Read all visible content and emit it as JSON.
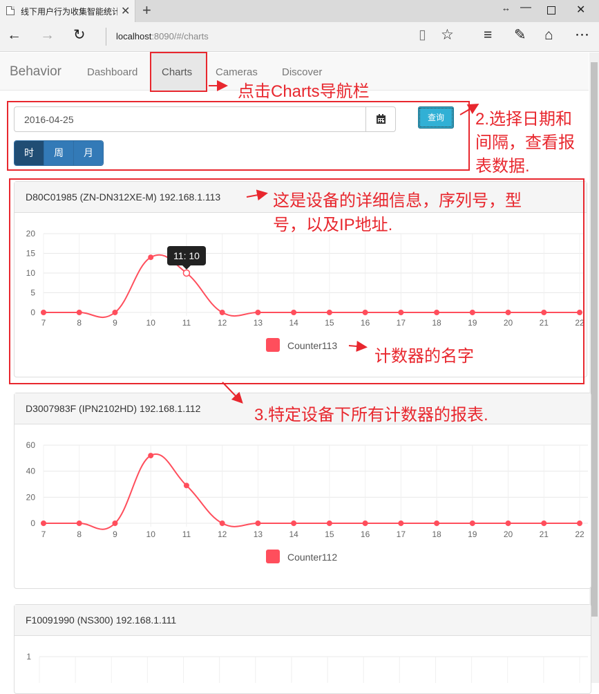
{
  "browser": {
    "tab_title": "线下用户行为收集智能统计",
    "address_host": "localhost",
    "address_rest": ":8090/#/charts",
    "newtab_glyph": "+",
    "close_glyph": "✕"
  },
  "app": {
    "brand": "Behavior",
    "nav": [
      {
        "label": "Dashboard"
      },
      {
        "label": "Charts",
        "active": true
      },
      {
        "label": "Cameras"
      },
      {
        "label": "Discover"
      }
    ]
  },
  "controls": {
    "date_value": "2016-04-25",
    "query_label": "查询",
    "intervals": [
      {
        "label": "时",
        "active": true
      },
      {
        "label": "周"
      },
      {
        "label": "月"
      }
    ]
  },
  "devices": [
    {
      "header": "D80C01985 (ZN-DN312XE-M) 192.168.1.113",
      "legend": "Counter113",
      "tooltip": "11: 10"
    },
    {
      "header": "D3007983F (IPN2102HD) 192.168.1.112",
      "legend": "Counter112"
    },
    {
      "header": "F10091990 (NS300) 192.168.1.111"
    }
  ],
  "annotations": {
    "a1": "点击Charts导航栏",
    "a2_line1": "2.选择日期和",
    "a2_line2": "间隔，查看报",
    "a2_line3": "表数据.",
    "a3_line1": "这是设备的详细信息，序列号，型",
    "a3_line2": "号，以及IP地址.",
    "a4": "计数器的名字",
    "a5": "3.特定设备下所有计数器的报表."
  },
  "colors": {
    "series": "#ff4e5c",
    "annotation": "#e8272e",
    "primary": "#337ab7",
    "query": "#31b0d5"
  },
  "chart_data": [
    {
      "type": "line",
      "x": [
        7,
        8,
        9,
        10,
        11,
        12,
        13,
        14,
        15,
        16,
        17,
        18,
        19,
        20,
        21,
        22
      ],
      "series": [
        {
          "name": "Counter113",
          "values": [
            0,
            0,
            0,
            14,
            10,
            0,
            0,
            0,
            0,
            0,
            0,
            0,
            0,
            0,
            0,
            0
          ]
        }
      ],
      "yticks": [
        0,
        5,
        10,
        15,
        20
      ],
      "ylim": [
        0,
        20
      ],
      "grid": true,
      "legend": "bottom"
    },
    {
      "type": "line",
      "x": [
        7,
        8,
        9,
        10,
        11,
        12,
        13,
        14,
        15,
        16,
        17,
        18,
        19,
        20,
        21,
        22
      ],
      "series": [
        {
          "name": "Counter112",
          "values": [
            0,
            0,
            0,
            52,
            29,
            0,
            0,
            0,
            0,
            0,
            0,
            0,
            0,
            0,
            0,
            0
          ]
        }
      ],
      "yticks": [
        0,
        20,
        40,
        60
      ],
      "ylim": [
        0,
        60
      ],
      "grid": true,
      "legend": "bottom"
    },
    {
      "type": "line",
      "x": [],
      "series": [],
      "yticks": [
        1
      ],
      "ylim": [
        0,
        1
      ],
      "grid": true
    }
  ]
}
